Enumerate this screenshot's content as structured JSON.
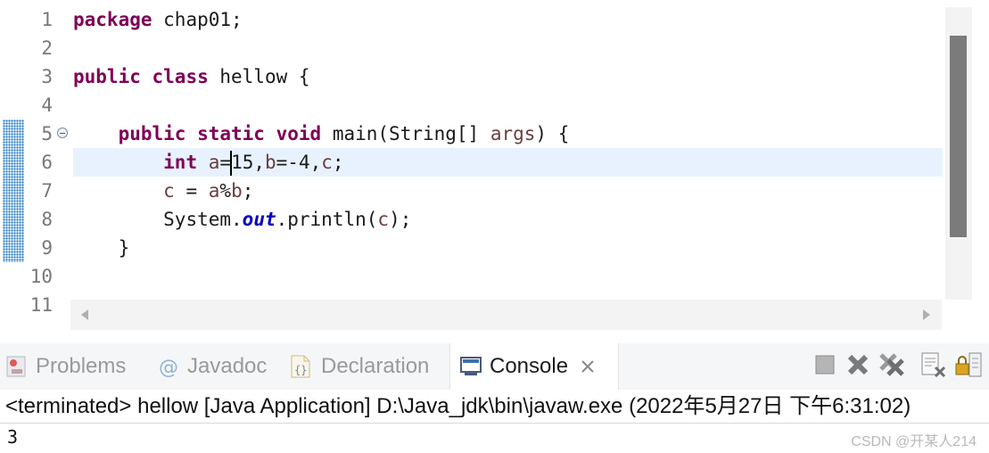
{
  "editor": {
    "line_numbers": [
      "1",
      "2",
      "3",
      "4",
      "5",
      "6",
      "7",
      "8",
      "9",
      "10",
      "11"
    ],
    "code": {
      "l1_kw": "package",
      "l1_rest": " chap01;",
      "l3_kw1": "public",
      "l3_kw2": "class",
      "l3_rest": " hellow {",
      "l5_indent": "    ",
      "l5_kw1": "public",
      "l5_kw2": "static",
      "l5_kw3": "void",
      "l5_mid": " main(String[] ",
      "l5_param": "args",
      "l5_end": ") {",
      "l6_indent": "        ",
      "l6_kw": "int",
      "l6_a": "a",
      "l6_eq": "=",
      "l6_n1": "15,",
      "l6_b": "b",
      "l6_n2": "=-4,",
      "l6_c": "c",
      "l6_semi": ";",
      "l7_indent": "        ",
      "l7_c": "c",
      "l7_eq": " = ",
      "l7_a": "a",
      "l7_mod": "%",
      "l7_b": "b",
      "l7_semi": ";",
      "l8_indent": "        ",
      "l8_sys": "System.",
      "l8_out": "out",
      "l8_println": ".println(",
      "l8_c": "c",
      "l8_end": ");",
      "l9": "    }",
      "l11": "}"
    }
  },
  "console_view": {
    "tabs": [
      {
        "label": "Problems",
        "icon": "problems-icon"
      },
      {
        "label": "Javadoc",
        "icon": "at-icon"
      },
      {
        "label": "Declaration",
        "icon": "declaration-icon"
      },
      {
        "label": "Console",
        "icon": "console-icon",
        "active": true
      }
    ],
    "toolbar_icons": [
      "terminate-icon",
      "remove-launch-icon",
      "remove-all-terminated-icon",
      "clear-console-icon",
      "scroll-lock-icon"
    ],
    "status_line": "<terminated> hellow [Java Application] D:\\Java_jdk\\bin\\javaw.exe (2022年5月27日 下午6:31:02)",
    "output": "3"
  },
  "watermark": "CSDN @开某人214",
  "colors": {
    "keyword": "#7f0055",
    "variable": "#6a3e3e",
    "static_field": "#0000c0",
    "current_line": "#e8f2fe"
  }
}
